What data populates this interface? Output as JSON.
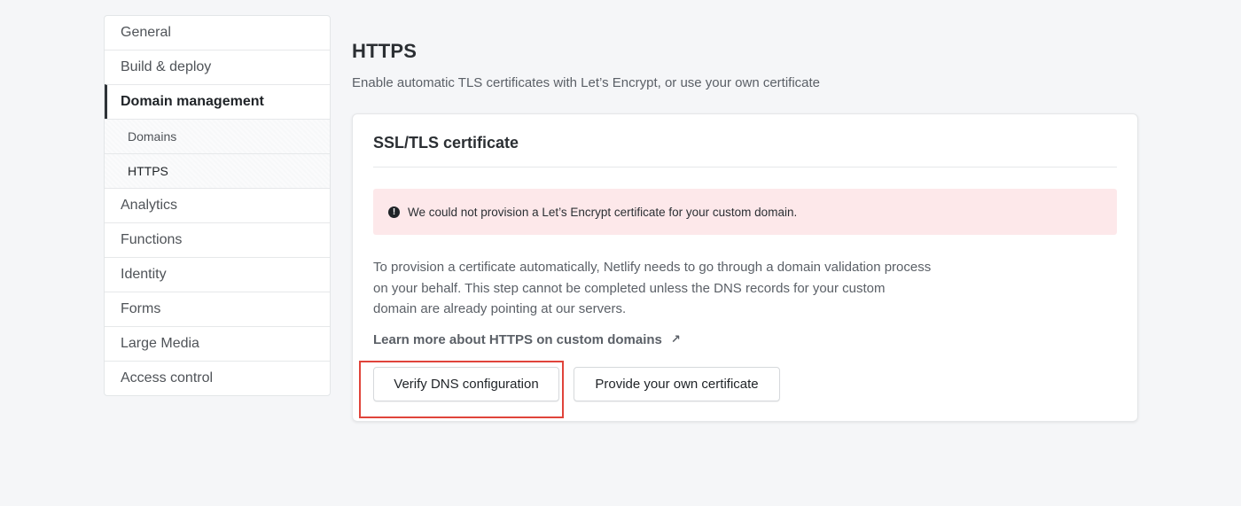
{
  "sidebar": {
    "items": [
      {
        "label": "General"
      },
      {
        "label": "Build & deploy"
      },
      {
        "label": "Domain management"
      },
      {
        "label": "Domains"
      },
      {
        "label": "HTTPS"
      },
      {
        "label": "Analytics"
      },
      {
        "label": "Functions"
      },
      {
        "label": "Identity"
      },
      {
        "label": "Forms"
      },
      {
        "label": "Large Media"
      },
      {
        "label": "Access control"
      }
    ],
    "active": "Domain management",
    "current_sub": "HTTPS"
  },
  "main": {
    "title": "HTTPS",
    "subtitle": "Enable automatic TLS certificates with Let’s Encrypt, or use your own certificate",
    "card": {
      "title": "SSL/TLS certificate",
      "alert": {
        "icon": "exclamation-circle-icon",
        "text": "We could not provision a Let’s Encrypt certificate for your custom domain."
      },
      "body": "To provision a certificate automatically, Netlify needs to go through a domain validation process on your behalf. This step cannot be completed unless the DNS records for your custom domain are already pointing at our servers.",
      "link_label": "Learn more about HTTPS on custom domains",
      "link_icon": "external-arrow-icon",
      "buttons": {
        "verify": "Verify DNS configuration",
        "provide": "Provide your own certificate"
      }
    }
  },
  "colors": {
    "alert_background": "#fde8ea",
    "highlight": "#e0443b",
    "page_background": "#f5f6f8"
  }
}
